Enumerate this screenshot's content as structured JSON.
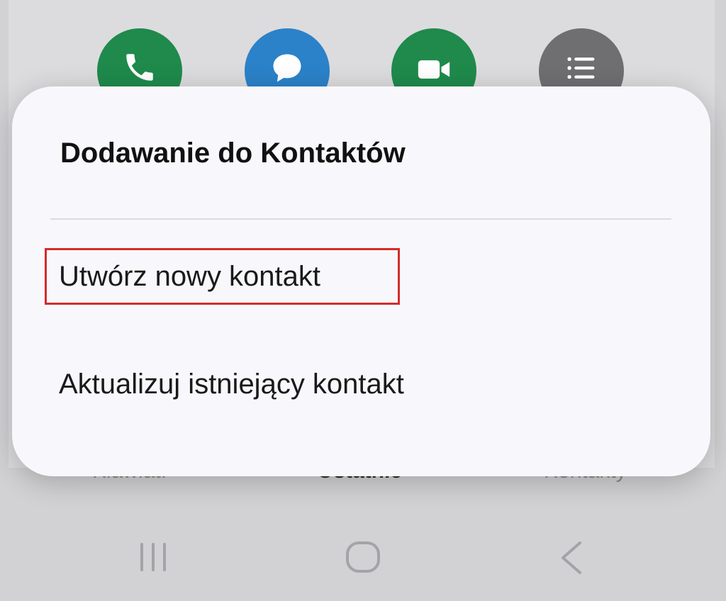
{
  "quick_actions": [
    {
      "icon": "phone-icon",
      "color": "#1f8a4c"
    },
    {
      "icon": "message-icon",
      "color": "#2b82c9"
    },
    {
      "icon": "video-call-icon",
      "color": "#1f8a4c"
    },
    {
      "icon": "details-icon",
      "color": "#6f6f72"
    }
  ],
  "bottom_tabs": {
    "keypad": "Klawiat.",
    "recents": "Ostatnie",
    "contacts": "Kontakty"
  },
  "dialog": {
    "title": "Dodawanie do Kontaktów",
    "options": [
      {
        "label": "Utwórz nowy kontakt",
        "highlighted": true,
        "highlight_color": "#d42b2b"
      },
      {
        "label": "Aktualizuj istniejący kontakt",
        "highlighted": false
      }
    ]
  },
  "navbar": {
    "icons": [
      "recent-apps-icon",
      "home-icon",
      "back-icon"
    ]
  }
}
